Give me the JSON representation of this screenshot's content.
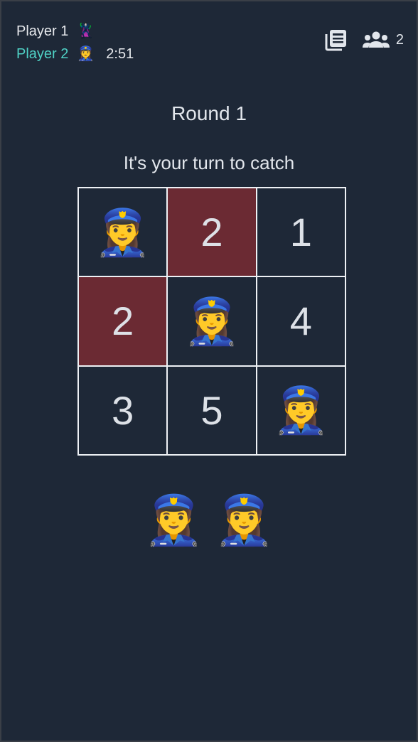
{
  "header": {
    "players": [
      {
        "name": "Player 1",
        "emoji": "🦹‍♀️",
        "active": false
      },
      {
        "name": "Player 2",
        "emoji": "👮‍♀️",
        "active": true
      }
    ],
    "timer": "2:51",
    "viewer_count": "2",
    "colors": {
      "active_player": "#4fd1c5",
      "background": "#1e2837",
      "marked_cell": "#6b2a33"
    }
  },
  "game": {
    "round_title": "Round 1",
    "status": "It's your turn to catch",
    "board": [
      {
        "content": "👮‍♀️",
        "kind": "emoji",
        "highlight": false
      },
      {
        "content": "2",
        "kind": "number",
        "highlight": true
      },
      {
        "content": "1",
        "kind": "number",
        "highlight": false
      },
      {
        "content": "2",
        "kind": "number",
        "highlight": true
      },
      {
        "content": "👮‍♀️",
        "kind": "emoji",
        "highlight": false
      },
      {
        "content": "4",
        "kind": "number",
        "highlight": false
      },
      {
        "content": "3",
        "kind": "number",
        "highlight": false
      },
      {
        "content": "5",
        "kind": "number",
        "highlight": false
      },
      {
        "content": "👮‍♀️",
        "kind": "emoji",
        "highlight": false
      }
    ],
    "tray": [
      "👮‍♀️",
      "👮‍♀️"
    ]
  },
  "icons": {
    "history": "newspaper-icon",
    "viewers": "users-icon"
  }
}
